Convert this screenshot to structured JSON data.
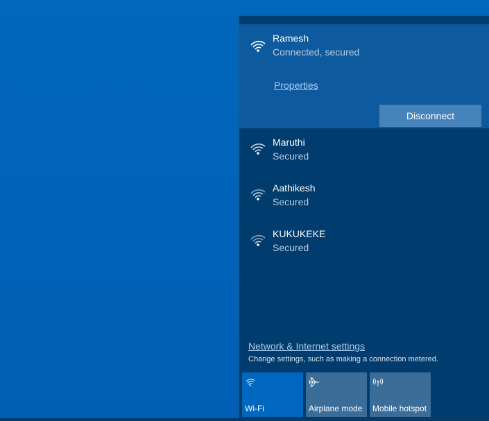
{
  "flyout": {
    "connected_network": {
      "name": "Ramesh",
      "status": "Connected, secured",
      "properties_label": "Properties",
      "disconnect_label": "Disconnect"
    },
    "networks": [
      {
        "name": "Maruthi",
        "status": "Secured"
      },
      {
        "name": "Aathikesh",
        "status": "Secured"
      },
      {
        "name": "KUKUKEKE",
        "status": "Secured"
      }
    ],
    "settings": {
      "link_label": "Network & Internet settings",
      "description": "Change settings, such as making a connection metered."
    },
    "quick_actions": [
      {
        "label": "Wi-Fi",
        "icon": "wifi-icon",
        "active": true
      },
      {
        "label": "Airplane mode",
        "icon": "airplane-icon",
        "active": false
      },
      {
        "label": "Mobile hotspot",
        "icon": "hotspot-icon",
        "active": false
      }
    ]
  },
  "colors": {
    "desktop": "#0063b1",
    "flyout_bg": "#003c6d",
    "connected_bg": "#0e5a9e",
    "tile_active": "#0067c0",
    "tile_inactive": "#3b6d99",
    "link": "#a9cdf0"
  }
}
